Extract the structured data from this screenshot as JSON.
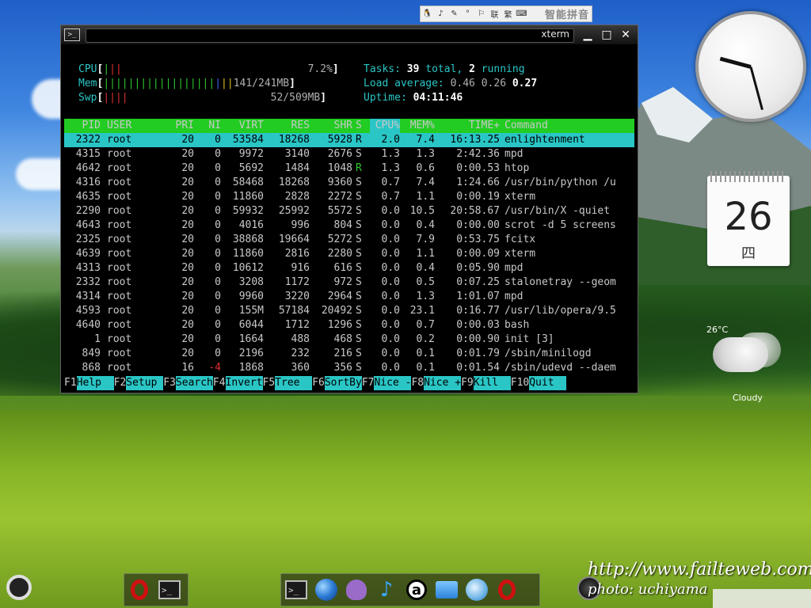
{
  "ime": {
    "name": "智能拼音",
    "buttons": [
      "penguin-icon",
      "ime-logo-icon",
      "feather-icon",
      "punct-icon",
      "simplified-traditional-icon",
      "lianxiang",
      "traditional",
      "keyboard-icon"
    ],
    "lianxiang_label": "联",
    "traditional_label": "繁"
  },
  "xterm": {
    "title": "xterm",
    "meters": {
      "cpu_label": "CPU",
      "cpu_value": "7.2%",
      "mem_label": "Mem",
      "mem_value": "141/241MB",
      "swp_label": "Swp",
      "swp_value": "52/509MB"
    },
    "summary": {
      "tasks_label": "Tasks: ",
      "tasks_total": "39",
      "tasks_mid": " total, ",
      "tasks_running": "2",
      "tasks_end": " running",
      "load_label": "Load average: ",
      "load_1": "0.46",
      "load_5": "0.26",
      "load_15": "0.27",
      "uptime_label": "Uptime: ",
      "uptime_value": "04:11:46"
    },
    "columns": [
      "PID",
      "USER",
      "PRI",
      "NI",
      "VIRT",
      "RES",
      "SHR",
      "S",
      "CPU%",
      "MEM%",
      "TIME+",
      "Command"
    ],
    "rows": [
      {
        "pid": "2322",
        "user": "root",
        "pri": "20",
        "ni": "0",
        "virt": "53584",
        "res": "18268",
        "shr": "5928",
        "s": "R",
        "cpu": "2.0",
        "mem": "7.4",
        "time": "16:13.25",
        "cmd": "enlightenment"
      },
      {
        "pid": "4315",
        "user": "root",
        "pri": "20",
        "ni": "0",
        "virt": "9972",
        "res": "3140",
        "shr": "2676",
        "s": "S",
        "cpu": "1.3",
        "mem": "1.3",
        "time": "2:42.36",
        "cmd": "mpd"
      },
      {
        "pid": "4642",
        "user": "root",
        "pri": "20",
        "ni": "0",
        "virt": "5692",
        "res": "1484",
        "shr": "1048",
        "s": "R",
        "cpu": "1.3",
        "mem": "0.6",
        "time": "0:00.53",
        "cmd": "htop"
      },
      {
        "pid": "4316",
        "user": "root",
        "pri": "20",
        "ni": "0",
        "virt": "58468",
        "res": "18268",
        "shr": "9360",
        "s": "S",
        "cpu": "0.7",
        "mem": "7.4",
        "time": "1:24.66",
        "cmd": "/usr/bin/python /u"
      },
      {
        "pid": "4635",
        "user": "root",
        "pri": "20",
        "ni": "0",
        "virt": "11860",
        "res": "2828",
        "shr": "2272",
        "s": "S",
        "cpu": "0.7",
        "mem": "1.1",
        "time": "0:00.19",
        "cmd": "xterm"
      },
      {
        "pid": "2290",
        "user": "root",
        "pri": "20",
        "ni": "0",
        "virt": "59932",
        "res": "25992",
        "shr": "5572",
        "s": "S",
        "cpu": "0.0",
        "mem": "10.5",
        "time": "20:58.67",
        "cmd": "/usr/bin/X -quiet"
      },
      {
        "pid": "4643",
        "user": "root",
        "pri": "20",
        "ni": "0",
        "virt": "4016",
        "res": "996",
        "shr": "804",
        "s": "S",
        "cpu": "0.0",
        "mem": "0.4",
        "time": "0:00.00",
        "cmd": "scrot -d 5 screens"
      },
      {
        "pid": "2325",
        "user": "root",
        "pri": "20",
        "ni": "0",
        "virt": "38868",
        "res": "19664",
        "shr": "5272",
        "s": "S",
        "cpu": "0.0",
        "mem": "7.9",
        "time": "0:53.75",
        "cmd": "fcitx"
      },
      {
        "pid": "4639",
        "user": "root",
        "pri": "20",
        "ni": "0",
        "virt": "11860",
        "res": "2816",
        "shr": "2280",
        "s": "S",
        "cpu": "0.0",
        "mem": "1.1",
        "time": "0:00.09",
        "cmd": "xterm"
      },
      {
        "pid": "4313",
        "user": "root",
        "pri": "20",
        "ni": "0",
        "virt": "10612",
        "res": "916",
        "shr": "616",
        "s": "S",
        "cpu": "0.0",
        "mem": "0.4",
        "time": "0:05.90",
        "cmd": "mpd"
      },
      {
        "pid": "2332",
        "user": "root",
        "pri": "20",
        "ni": "0",
        "virt": "3208",
        "res": "1172",
        "shr": "972",
        "s": "S",
        "cpu": "0.0",
        "mem": "0.5",
        "time": "0:07.25",
        "cmd": "stalonetray --geom"
      },
      {
        "pid": "4314",
        "user": "root",
        "pri": "20",
        "ni": "0",
        "virt": "9960",
        "res": "3220",
        "shr": "2964",
        "s": "S",
        "cpu": "0.0",
        "mem": "1.3",
        "time": "1:01.07",
        "cmd": "mpd"
      },
      {
        "pid": "4593",
        "user": "root",
        "pri": "20",
        "ni": "0",
        "virt": "155M",
        "res": "57184",
        "shr": "20492",
        "s": "S",
        "cpu": "0.0",
        "mem": "23.1",
        "time": "0:16.77",
        "cmd": "/usr/lib/opera/9.5"
      },
      {
        "pid": "4640",
        "user": "root",
        "pri": "20",
        "ni": "0",
        "virt": "6044",
        "res": "1712",
        "shr": "1296",
        "s": "S",
        "cpu": "0.0",
        "mem": "0.7",
        "time": "0:00.03",
        "cmd": "bash"
      },
      {
        "pid": "1",
        "user": "root",
        "pri": "20",
        "ni": "0",
        "virt": "1664",
        "res": "488",
        "shr": "468",
        "s": "S",
        "cpu": "0.0",
        "mem": "0.2",
        "time": "0:00.90",
        "cmd": "init [3]"
      },
      {
        "pid": "849",
        "user": "root",
        "pri": "20",
        "ni": "0",
        "virt": "2196",
        "res": "232",
        "shr": "216",
        "s": "S",
        "cpu": "0.0",
        "mem": "0.1",
        "time": "0:01.79",
        "cmd": "/sbin/minilogd"
      },
      {
        "pid": "868",
        "user": "root",
        "pri": "16",
        "ni": "-4",
        "virt": "1868",
        "res": "360",
        "shr": "356",
        "s": "S",
        "cpu": "0.0",
        "mem": "0.1",
        "time": "0:01.54",
        "cmd": "/sbin/udevd --daem"
      }
    ],
    "fkeys": [
      {
        "n": "F1",
        "l": "Help  "
      },
      {
        "n": "F2",
        "l": "Setup "
      },
      {
        "n": "F3",
        "l": "Search"
      },
      {
        "n": "F4",
        "l": "Invert"
      },
      {
        "n": "F5",
        "l": "Tree  "
      },
      {
        "n": "F6",
        "l": "SortBy"
      },
      {
        "n": "F7",
        "l": "Nice -"
      },
      {
        "n": "F8",
        "l": "Nice +"
      },
      {
        "n": "F9",
        "l": "Kill  "
      },
      {
        "n": "F10",
        "l": "Quit  "
      }
    ]
  },
  "calendar": {
    "day": "26",
    "weekday": "四"
  },
  "weather": {
    "temp": "26°C",
    "condition": "Cloudy"
  },
  "watermark": {
    "line1": "http://www.failteweb.com/",
    "line2": "photo: uchiyama"
  },
  "colors": {
    "htop_green": "#22cc22",
    "htop_cyan": "#2ac6c6",
    "red": "#e03030"
  }
}
